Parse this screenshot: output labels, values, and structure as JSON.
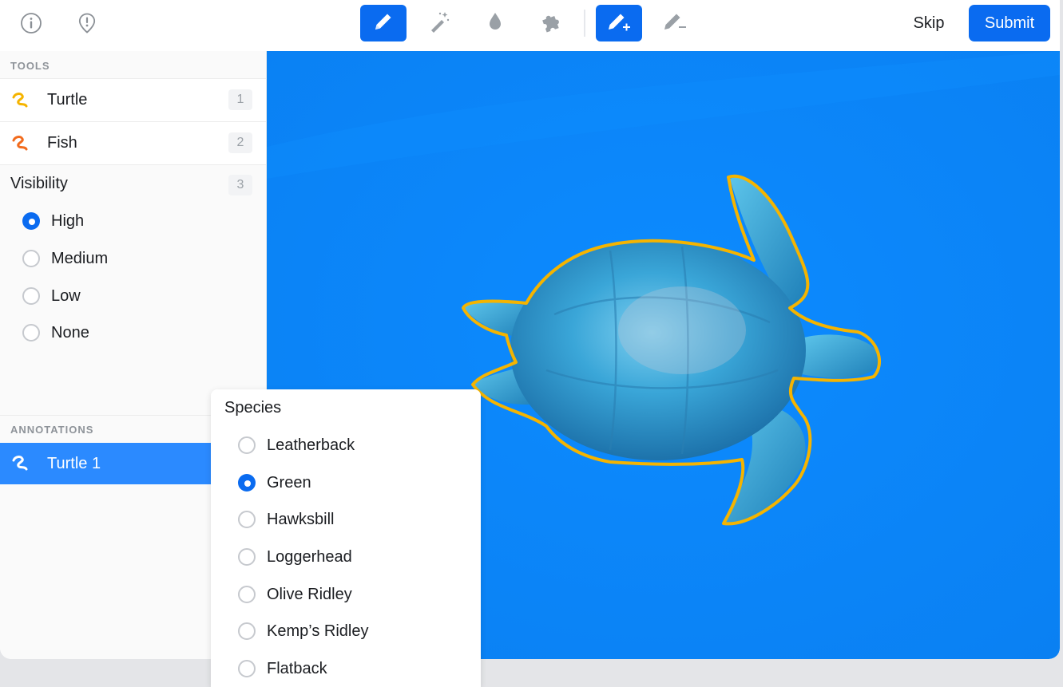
{
  "toolbar": {
    "left_icons": [
      "info-icon",
      "alert-pin-icon"
    ],
    "tools": [
      {
        "name": "pencil-tool",
        "icon": "pencil-icon",
        "active": true
      },
      {
        "name": "magic-wand-tool",
        "icon": "magic-wand-icon",
        "active": false
      },
      {
        "name": "drop-tool",
        "icon": "drop-icon",
        "active": false
      },
      {
        "name": "puzzle-tool",
        "icon": "puzzle-icon",
        "active": false
      },
      {
        "name": "pencil-add-tool",
        "icon": "pencil-plus-icon",
        "active": true
      },
      {
        "name": "pencil-subtract-tool",
        "icon": "pencil-minus-icon",
        "active": false
      }
    ],
    "skip_label": "Skip",
    "submit_label": "Submit"
  },
  "sidebar": {
    "tools_header": "TOOLS",
    "tools": [
      {
        "label": "Turtle",
        "key": "1",
        "color": "#f5b400"
      },
      {
        "label": "Fish",
        "key": "2",
        "color": "#f26b1d"
      }
    ],
    "visibility": {
      "label": "Visibility",
      "key": "3",
      "options": [
        "High",
        "Medium",
        "Low",
        "None"
      ],
      "selected": "High"
    },
    "annotations_header": "ANNOTATIONS",
    "annotations": [
      {
        "label": "Turtle 1",
        "selected": true
      }
    ]
  },
  "species_popup": {
    "title": "Species",
    "options": [
      "Leatherback",
      "Green",
      "Hawksbill",
      "Loggerhead",
      "Olive Ridley",
      "Kemp’s Ridley",
      "Flatback"
    ],
    "selected": "Green"
  },
  "colors": {
    "accent": "#0a6bf0",
    "selection": "#2b8aff",
    "canvas_water": "#0b85f5",
    "outline": "#f5b400"
  }
}
